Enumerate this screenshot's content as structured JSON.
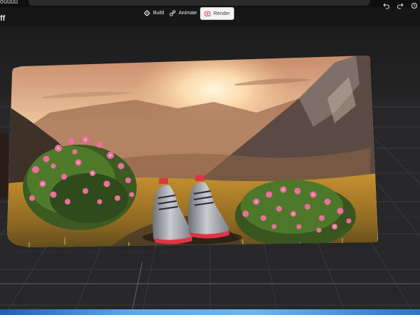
{
  "app": {
    "project_title": "ouuuu",
    "left_label": "ff"
  },
  "toolbar": {
    "modes": [
      {
        "label": "Build",
        "icon": "gear-icon",
        "active": false
      },
      {
        "label": "Animate",
        "icon": "animate-icon",
        "active": false
      },
      {
        "label": "Render",
        "icon": "render-icon",
        "active": true
      }
    ],
    "right_icons": [
      "undo-icon",
      "redo-icon",
      "history-icon"
    ]
  },
  "viewport": {
    "image_subject": "pair of silver sneakers with red accents between pink flower bushes in a mountain valley at sunset"
  },
  "colors": {
    "toolbar_bg": "#161617",
    "viewport_bg": "#202021",
    "grid_line": "#3c3c40",
    "accent_blue": "#4a94dc",
    "flower_pink": "#ee6f9b",
    "sneaker_red": "#e23345"
  }
}
